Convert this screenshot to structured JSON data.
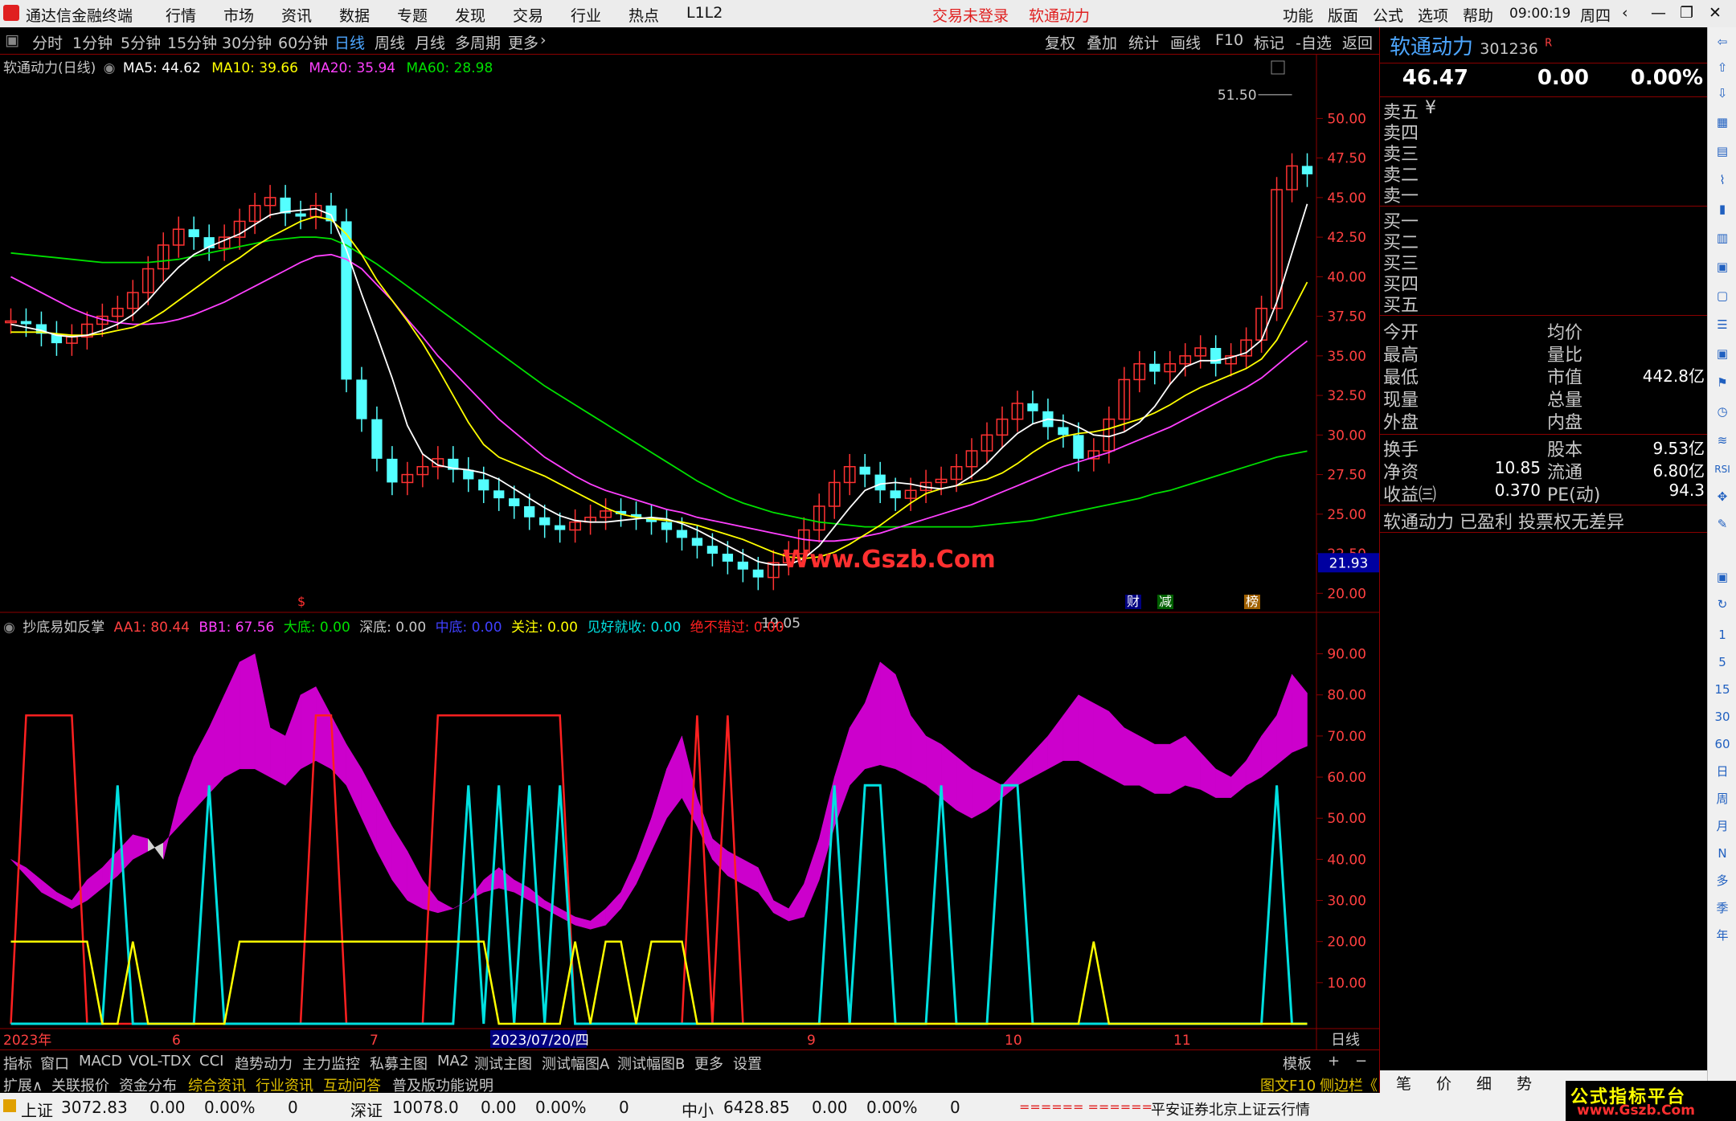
{
  "titlebar": {
    "app_title": "通达信金融终端",
    "menu": [
      "行情",
      "市场",
      "资讯",
      "数据",
      "专题",
      "发现",
      "交易",
      "行业",
      "热点",
      "L1L2"
    ],
    "login_status": "交易未登录",
    "stock_short": "软通动力",
    "right_menu": [
      "功能",
      "版面",
      "公式",
      "选项",
      "帮助"
    ],
    "clock": "09:00:19",
    "weekday": "周四"
  },
  "chart_toolbar": {
    "periods": [
      "分时",
      "1分钟",
      "5分钟",
      "15分钟",
      "30分钟",
      "60分钟",
      "日线",
      "周线",
      "月线",
      "多周期",
      "更多"
    ],
    "active_period": "日线",
    "tools": [
      "复权",
      "叠加",
      "统计",
      "画线",
      "F10",
      "标记",
      "-自选",
      "返回"
    ]
  },
  "main_chart": {
    "title": "软通动力(日线)",
    "ma5": "MA5: 44.62",
    "ma10": "MA10: 39.66",
    "ma20": "MA20: 35.94",
    "ma60": "MA60: 28.98",
    "high_mark": "51.50",
    "low_mark": "19.05",
    "current_price_tag": "21.93",
    "watermark": "Www.Gszb.Com",
    "event_marks": [
      "$",
      "财",
      "减",
      "榜"
    ]
  },
  "indicator": {
    "name": "抄底易如反掌",
    "aa1": "AA1: 80.44",
    "bb1": "BB1: 67.56",
    "dadi": "大底: 0.00",
    "shendi": "深底: 0.00",
    "zhongdi": "中底: 0.00",
    "guanzhu": "关注: 0.00",
    "jianhao": "见好就收: 0.00",
    "juebu": "绝不错过: 0.00"
  },
  "time_axis": {
    "labels": [
      "2023年",
      "6",
      "7",
      "2023/07/20/四",
      "9",
      "10",
      "11"
    ],
    "period": "日线"
  },
  "bottom_tabs": {
    "row1": [
      "指标",
      "窗口",
      "MACD",
      "VOL-TDX",
      "CCI",
      "趋势动力",
      "主力监控",
      "私募主图",
      "MA2",
      "测试主图",
      "测试幅图A",
      "测试幅图B",
      "更多",
      "设置"
    ],
    "row2": [
      "扩展∧",
      "关联报价",
      "资金分布",
      "综合资讯",
      "行业资讯",
      "互动问答",
      "普及版功能说明"
    ],
    "template": "模板",
    "right2": "图文F10",
    "right3": "侧边栏《"
  },
  "quote": {
    "name": "软通动力",
    "code": "301236",
    "badge": "R",
    "price": "46.47",
    "change": "0.00",
    "pct": "0.00%",
    "sell": [
      "卖五",
      "卖四",
      "卖三",
      "卖二",
      "卖一"
    ],
    "buy": [
      "买一",
      "买二",
      "买三",
      "买四",
      "买五"
    ],
    "yen": "¥",
    "stats_left": [
      "今开",
      "最高",
      "最低",
      "现量",
      "外盘"
    ],
    "stats_right": [
      "均价",
      "量比",
      "市值",
      "总量",
      "内盘"
    ],
    "market_cap": "442.8亿",
    "fin": [
      [
        "换手",
        "",
        "股本",
        "9.53亿"
      ],
      [
        "净资",
        "10.85",
        "流通",
        "6.80亿"
      ],
      [
        "收益㈢",
        "0.370",
        "PE(动)",
        "94.3"
      ]
    ],
    "notice": "软通动力 已盈利 投票权无差异",
    "tabs": [
      "笔",
      "价",
      "细",
      "势"
    ]
  },
  "right_tools": [
    "1",
    "5",
    "15",
    "30",
    "60",
    "日",
    "周",
    "月",
    "N",
    "多",
    "季",
    "年"
  ],
  "statusbar": {
    "sh_name": "上证",
    "sh_val": "3072.83",
    "sh_chg": "0.00",
    "sh_pct": "0.00%",
    "sh_vol": "0",
    "sz_name": "深证",
    "sz_val": "10078.0",
    "sz_chg": "0.00",
    "sz_pct": "0.00%",
    "sz_vol": "0",
    "zx_name": "中小",
    "zx_val": "6428.85",
    "zx_chg": "0.00",
    "zx_pct": "0.00%",
    "zx_vol": "0",
    "bars": "====== ======",
    "feed": "平安证券北京上证云行情",
    "logo": "公式指标平台",
    "logo_url": "www.Gszb.Com"
  },
  "chart_data": [
    {
      "type": "candlestick",
      "title": "软通动力(日线)",
      "y_ticks": [
        "50.00",
        "47.50",
        "45.00",
        "42.50",
        "40.00",
        "37.50",
        "35.00",
        "32.50",
        "30.00",
        "27.50",
        "25.00",
        "22.50",
        "20.00"
      ],
      "ylim": [
        19,
        52
      ],
      "close": [
        37.2,
        37.0,
        36.4,
        35.8,
        36.2,
        37.0,
        37.5,
        38.0,
        39.0,
        40.5,
        42.0,
        43.0,
        42.5,
        41.8,
        42.5,
        43.5,
        44.5,
        45.0,
        44.0,
        43.8,
        44.5,
        43.5,
        33.5,
        31.0,
        28.5,
        27.0,
        27.5,
        28.0,
        28.5,
        27.8,
        27.2,
        26.5,
        26.0,
        25.5,
        24.8,
        24.3,
        24.0,
        24.5,
        24.8,
        25.2,
        25.0,
        24.8,
        24.5,
        24.0,
        23.5,
        23.0,
        22.5,
        22.0,
        21.5,
        21.0,
        21.93,
        22.5,
        24.0,
        25.5,
        27.0,
        28.0,
        27.5,
        26.5,
        26.0,
        26.5,
        27.0,
        27.2,
        28.0,
        29.0,
        30.0,
        31.0,
        32.0,
        31.5,
        30.5,
        30.0,
        28.5,
        29.0,
        31.0,
        33.5,
        34.5,
        34.0,
        34.5,
        35.0,
        35.5,
        34.5,
        35.0,
        36.0,
        38.0,
        45.5,
        47.0,
        46.47
      ],
      "ma5": [
        37.0,
        36.8,
        36.6,
        36.3,
        36.2,
        36.3,
        36.6,
        37.0,
        37.6,
        38.5,
        39.6,
        40.6,
        41.4,
        41.9,
        42.3,
        42.7,
        43.3,
        43.9,
        44.1,
        44.2,
        44.3,
        43.9,
        41.7,
        38.9,
        36.3,
        33.6,
        30.6,
        28.8,
        28.1,
        27.9,
        27.8,
        27.6,
        27.2,
        26.6,
        26.0,
        25.4,
        24.9,
        24.6,
        24.5,
        24.5,
        24.6,
        24.7,
        24.8,
        24.7,
        24.4,
        24.0,
        23.5,
        23.0,
        22.5,
        22.0,
        21.8,
        21.8,
        22.2,
        23.0,
        24.2,
        25.4,
        26.5,
        26.9,
        27.0,
        26.9,
        26.7,
        26.6,
        26.8,
        27.4,
        28.2,
        29.2,
        30.1,
        30.7,
        31.0,
        30.9,
        30.5,
        30.0,
        29.9,
        30.2,
        30.8,
        31.8,
        33.2,
        34.3,
        34.7,
        34.7,
        34.9,
        35.2,
        36.0,
        38.4,
        41.5,
        44.6
      ],
      "ma10": [
        36.5,
        36.5,
        36.5,
        36.4,
        36.3,
        36.3,
        36.4,
        36.6,
        36.8,
        37.2,
        37.8,
        38.5,
        39.2,
        39.9,
        40.6,
        41.2,
        41.9,
        42.5,
        43.0,
        43.5,
        43.8,
        43.6,
        42.7,
        41.4,
        39.8,
        38.5,
        37.2,
        35.8,
        34.2,
        32.5,
        30.8,
        29.4,
        28.6,
        28.2,
        27.8,
        27.4,
        26.9,
        26.4,
        25.9,
        25.4,
        25.0,
        24.8,
        24.7,
        24.6,
        24.5,
        24.3,
        24.0,
        23.7,
        23.4,
        23.0,
        22.6,
        22.3,
        22.2,
        22.3,
        22.6,
        23.1,
        23.7,
        24.3,
        25.0,
        25.7,
        26.3,
        26.6,
        26.8,
        27.0,
        27.2,
        27.6,
        28.2,
        28.9,
        29.5,
        29.9,
        30.1,
        30.2,
        30.4,
        30.7,
        31.0,
        31.4,
        31.9,
        32.5,
        33.0,
        33.4,
        33.8,
        34.2,
        34.8,
        36.0,
        37.8,
        39.66
      ],
      "ma20": [
        40.0,
        39.5,
        39.0,
        38.5,
        38.0,
        37.6,
        37.3,
        37.1,
        37.0,
        37.0,
        37.1,
        37.3,
        37.6,
        38.0,
        38.4,
        38.9,
        39.4,
        39.9,
        40.4,
        40.9,
        41.3,
        41.4,
        41.1,
        40.5,
        39.5,
        38.5,
        37.3,
        36.2,
        35.0,
        34.0,
        33.0,
        32.0,
        31.0,
        30.2,
        29.4,
        28.6,
        28.0,
        27.4,
        26.9,
        26.5,
        26.2,
        25.9,
        25.6,
        25.3,
        25.1,
        24.8,
        24.6,
        24.4,
        24.2,
        24.0,
        23.8,
        23.6,
        23.4,
        23.3,
        23.3,
        23.4,
        23.6,
        23.8,
        24.1,
        24.4,
        24.7,
        25.0,
        25.3,
        25.6,
        26.0,
        26.4,
        26.8,
        27.2,
        27.6,
        28.0,
        28.3,
        28.6,
        28.9,
        29.3,
        29.7,
        30.1,
        30.5,
        31.0,
        31.5,
        32.0,
        32.5,
        33.0,
        33.6,
        34.4,
        35.2,
        35.94
      ],
      "ma60": [
        41.5,
        41.4,
        41.3,
        41.2,
        41.1,
        41.0,
        40.9,
        40.9,
        40.9,
        40.9,
        41.0,
        41.1,
        41.3,
        41.5,
        41.7,
        41.9,
        42.1,
        42.3,
        42.4,
        42.5,
        42.5,
        42.4,
        42.0,
        41.4,
        40.8,
        40.1,
        39.4,
        38.7,
        38.0,
        37.3,
        36.6,
        35.9,
        35.2,
        34.5,
        33.8,
        33.1,
        32.5,
        31.9,
        31.3,
        30.7,
        30.1,
        29.5,
        28.9,
        28.3,
        27.7,
        27.1,
        26.6,
        26.1,
        25.7,
        25.4,
        25.1,
        24.9,
        24.7,
        24.5,
        24.4,
        24.3,
        24.2,
        24.2,
        24.2,
        24.2,
        24.2,
        24.2,
        24.2,
        24.2,
        24.3,
        24.4,
        24.5,
        24.6,
        24.8,
        25.0,
        25.2,
        25.4,
        25.6,
        25.8,
        26.0,
        26.3,
        26.5,
        26.8,
        27.1,
        27.4,
        27.7,
        28.0,
        28.3,
        28.6,
        28.8,
        28.98
      ]
    },
    {
      "type": "area",
      "title": "抄底易如反掌",
      "y_ticks": [
        "90.00",
        "80.00",
        "70.00",
        "60.00",
        "50.00",
        "40.00",
        "30.00",
        "20.00",
        "10.00"
      ],
      "ylim": [
        0,
        95
      ],
      "series": [
        {
          "name": "AA1",
          "values": [
            40,
            38,
            35,
            32,
            30,
            35,
            38,
            42,
            46,
            45,
            40,
            55,
            65,
            72,
            80,
            88,
            90,
            72,
            70,
            80,
            82,
            75,
            68,
            62,
            55,
            48,
            42,
            35,
            30,
            28,
            30,
            35,
            38,
            35,
            33,
            30,
            28,
            26,
            25,
            28,
            32,
            40,
            50,
            62,
            70,
            55,
            45,
            42,
            40,
            38,
            30,
            28,
            34,
            45,
            60,
            72,
            78,
            88,
            85,
            75,
            70,
            68,
            65,
            62,
            60,
            58,
            62,
            66,
            70,
            75,
            80,
            78,
            76,
            72,
            70,
            68,
            68,
            70,
            66,
            62,
            60,
            64,
            70,
            75,
            85,
            80.44
          ]
        },
        {
          "name": "BB1",
          "values": [
            40,
            36,
            32,
            30,
            28,
            30,
            33,
            36,
            40,
            42,
            44,
            48,
            52,
            56,
            60,
            62,
            62,
            60,
            58,
            62,
            64,
            62,
            58,
            50,
            42,
            35,
            30,
            28,
            27,
            28,
            30,
            32,
            33,
            32,
            30,
            28,
            26,
            24,
            23,
            24,
            28,
            34,
            42,
            50,
            55,
            48,
            40,
            36,
            34,
            32,
            27,
            25,
            26,
            35,
            48,
            58,
            62,
            63,
            62,
            60,
            58,
            55,
            52,
            50,
            52,
            55,
            58,
            60,
            62,
            64,
            64,
            62,
            60,
            58,
            58,
            56,
            56,
            58,
            57,
            55,
            55,
            58,
            60,
            63,
            66,
            67.56
          ]
        },
        {
          "name": "关注",
          "values": [
            20,
            20,
            20,
            20,
            20,
            20,
            0,
            0,
            20,
            0,
            0,
            0,
            0,
            0,
            0,
            20,
            20,
            20,
            20,
            20,
            20,
            20,
            20,
            20,
            20,
            20,
            20,
            20,
            20,
            20,
            20,
            20,
            0,
            0,
            0,
            0,
            0,
            20,
            0,
            20,
            20,
            0,
            20,
            20,
            20,
            0,
            0,
            0,
            0,
            0,
            0,
            0,
            0,
            0,
            0,
            0,
            0,
            0,
            0,
            0,
            0,
            0,
            0,
            0,
            0,
            0,
            0,
            0,
            0,
            0,
            0,
            20,
            0,
            0,
            0,
            0,
            0,
            0,
            0,
            0,
            0,
            0,
            0,
            0,
            0,
            0
          ]
        },
        {
          "name": "见好就收",
          "values": [
            0,
            0,
            0,
            0,
            0,
            0,
            0,
            58,
            0,
            0,
            0,
            0,
            0,
            58,
            0,
            0,
            0,
            0,
            0,
            0,
            0,
            0,
            0,
            0,
            0,
            0,
            0,
            0,
            0,
            0,
            58,
            0,
            58,
            0,
            58,
            0,
            58,
            0,
            0,
            0,
            0,
            0,
            0,
            0,
            0,
            0,
            0,
            0,
            0,
            0,
            0,
            0,
            0,
            0,
            58,
            0,
            58,
            58,
            0,
            0,
            0,
            58,
            0,
            0,
            0,
            58,
            58,
            0,
            0,
            0,
            0,
            0,
            0,
            0,
            0,
            0,
            0,
            0,
            0,
            0,
            0,
            0,
            0,
            58,
            0,
            0
          ]
        },
        {
          "name": "绝不错过",
          "values": [
            0,
            75,
            75,
            75,
            75,
            0,
            0,
            0,
            0,
            0,
            0,
            0,
            0,
            0,
            0,
            0,
            0,
            0,
            0,
            0,
            75,
            75,
            0,
            0,
            0,
            0,
            0,
            0,
            75,
            75,
            75,
            75,
            75,
            75,
            75,
            75,
            75,
            0,
            0,
            0,
            0,
            0,
            0,
            0,
            0,
            75,
            0,
            75,
            0,
            0,
            0,
            0,
            0,
            0,
            0,
            0,
            0,
            0,
            0,
            0,
            0,
            0,
            0,
            0,
            0,
            0,
            0,
            0,
            0,
            0,
            0,
            0,
            0,
            0,
            0,
            0,
            0,
            0,
            0,
            0,
            0,
            0,
            0,
            0,
            0,
            0
          ]
        }
      ]
    }
  ]
}
